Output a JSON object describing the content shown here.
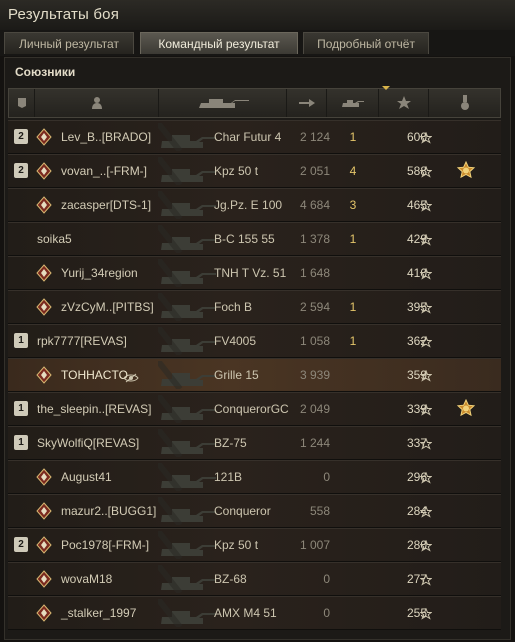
{
  "window": {
    "title": "Результаты боя"
  },
  "tabs": [
    {
      "label": "Личный результат",
      "active": false
    },
    {
      "label": "Командный результат",
      "active": true
    },
    {
      "label": "Подробный отчёт",
      "active": false
    }
  ],
  "section": {
    "label": "Союзники"
  },
  "header_icons": [
    "platoon-icon",
    "player-icon",
    "tank-icon",
    "damage-icon",
    "kills-icon",
    "xp-star-icon",
    "medal-icon"
  ],
  "colors": {
    "accent": "#d8b44a",
    "row_bg": "#2a221c",
    "player_row_bg": "#4a3523",
    "kills": "#e4c66a"
  },
  "rows": [
    {
      "platoon": "2",
      "badge": "rank-badge-icon",
      "name": "Lev_B..[BRADO]",
      "tank": "Char Futur 4",
      "damage": "2 124",
      "kills": "1",
      "xp": "600",
      "medal": ""
    },
    {
      "platoon": "2",
      "badge": "rank-badge-icon",
      "name": "vovan_..[-FRM-]",
      "tank": "Kpz 50 t",
      "damage": "2 051",
      "kills": "4",
      "xp": "588",
      "medal": "medal-icon"
    },
    {
      "platoon": "",
      "badge": "rank-badge-icon",
      "name": "zacasper[DTS-1]",
      "tank": "Jg.Pz. E 100",
      "damage": "4 684",
      "kills": "3",
      "xp": "465",
      "medal": ""
    },
    {
      "platoon": "",
      "badge": "",
      "name": "soika5",
      "tank": "B-C 155 55",
      "damage": "1 378",
      "kills": "1",
      "xp": "429",
      "medal": ""
    },
    {
      "platoon": "",
      "badge": "rank-badge-icon",
      "name": "Yurij_34region",
      "tank": "TNH T Vz. 51",
      "damage": "1 648",
      "kills": "",
      "xp": "410",
      "medal": ""
    },
    {
      "platoon": "",
      "badge": "rank-badge-icon",
      "name": "zVzCyM..[PITBS]",
      "tank": "Foch B",
      "damage": "2 594",
      "kills": "1",
      "xp": "395",
      "medal": ""
    },
    {
      "platoon": "1",
      "badge": "",
      "name": "rpk7777[REVAS]",
      "tank": "FV4005",
      "damage": "1 058",
      "kills": "1",
      "xp": "362",
      "medal": ""
    },
    {
      "platoon": "",
      "badge": "rank-badge-icon",
      "name": "TOHHACTO",
      "tank": "Grille 15",
      "damage": "3 939",
      "kills": "",
      "xp": "359",
      "medal": "",
      "me": true
    },
    {
      "platoon": "1",
      "badge": "",
      "name": "the_sleepin..[REVAS]",
      "tank": "ConquerorGC",
      "damage": "2 049",
      "kills": "",
      "xp": "339",
      "medal": "medal-icon"
    },
    {
      "platoon": "1",
      "badge": "",
      "name": "SkyWolfiQ[REVAS]",
      "tank": "BZ-75",
      "damage": "1 244",
      "kills": "",
      "xp": "337",
      "medal": ""
    },
    {
      "platoon": "",
      "badge": "rank-badge-icon",
      "name": "August41",
      "tank": "121B",
      "damage": "0",
      "kills": "",
      "xp": "296",
      "medal": ""
    },
    {
      "platoon": "",
      "badge": "rank-badge-icon",
      "name": "mazur2..[BUGG1]",
      "tank": "Conqueror",
      "damage": "558",
      "kills": "",
      "xp": "284",
      "medal": ""
    },
    {
      "platoon": "2",
      "badge": "rank-badge-icon",
      "name": "Poc1978[-FRM-]",
      "tank": "Kpz 50 t",
      "damage": "1 007",
      "kills": "",
      "xp": "280",
      "medal": ""
    },
    {
      "platoon": "",
      "badge": "rank-badge-icon",
      "name": "wovaM18",
      "tank": "BZ-68",
      "damage": "0",
      "kills": "",
      "xp": "277",
      "medal": ""
    },
    {
      "platoon": "",
      "badge": "rank-badge-icon",
      "name": "_stalker_1997",
      "tank": "AMX M4 51",
      "damage": "0",
      "kills": "",
      "xp": "255",
      "medal": ""
    }
  ]
}
